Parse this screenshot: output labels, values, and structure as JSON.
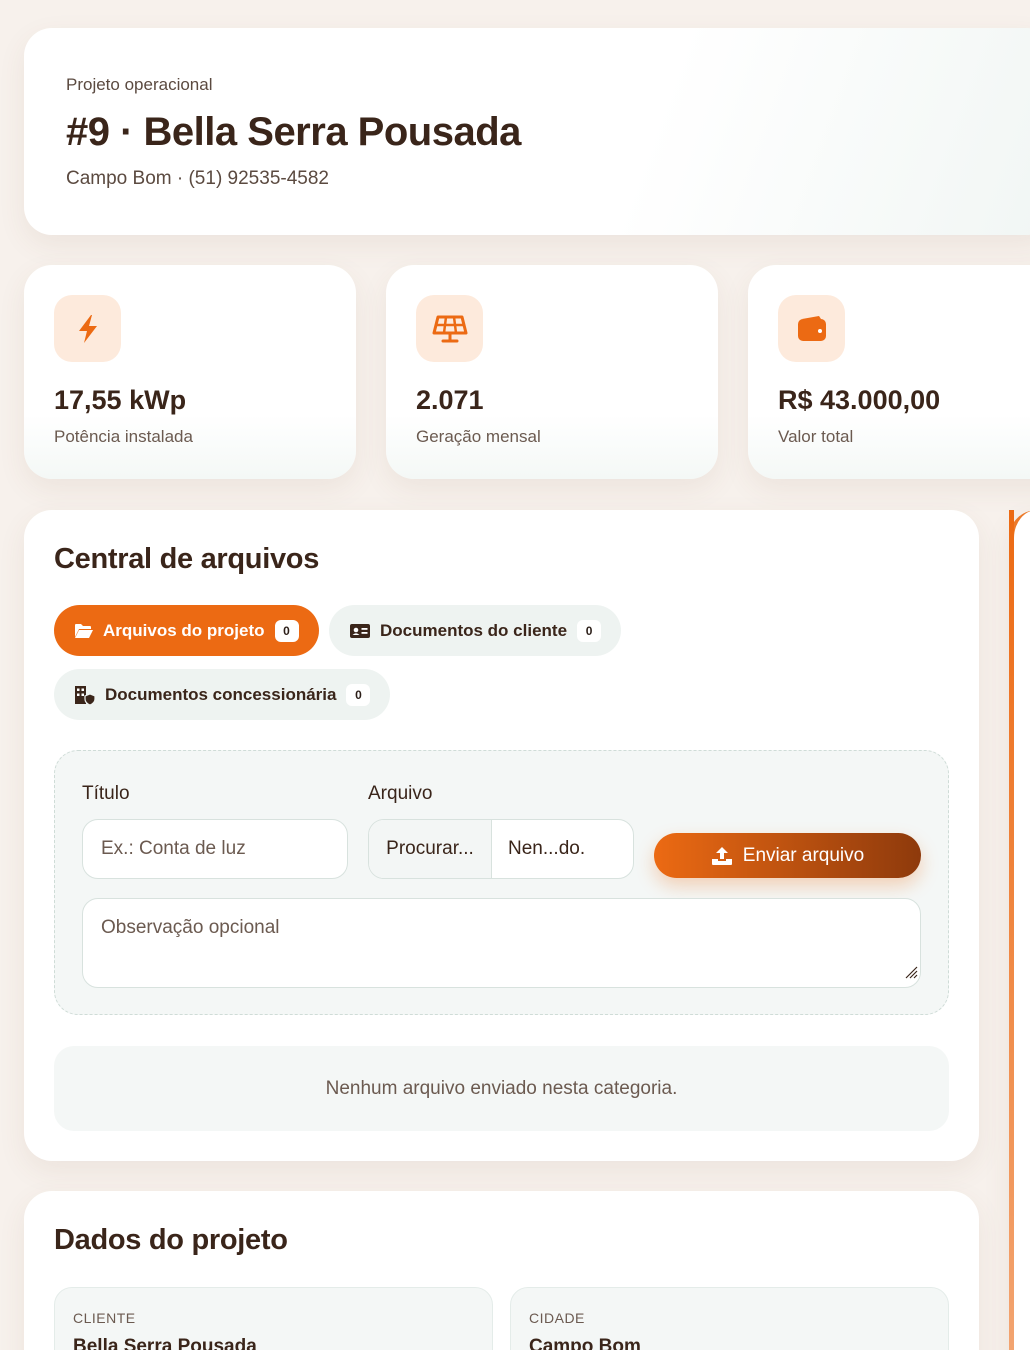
{
  "header": {
    "eyebrow": "Projeto operacional",
    "title": "#9 · Bella Serra Pousada",
    "subtitle": "Campo Bom · (51) 92535-4582"
  },
  "stats": [
    {
      "icon": "bolt-icon",
      "value": "17,55 kWp",
      "label": "Potência instalada"
    },
    {
      "icon": "solar-panel-icon",
      "value": "2.071",
      "label": "Geração mensal"
    },
    {
      "icon": "wallet-icon",
      "value": "R$ 43.000,00",
      "label": "Valor total"
    }
  ],
  "files": {
    "title": "Central de arquivos",
    "tabs": [
      {
        "label": "Arquivos do projeto",
        "count": "0",
        "icon": "folder-open-icon",
        "active": true
      },
      {
        "label": "Documentos do cliente",
        "count": "0",
        "icon": "id-card-icon",
        "active": false
      },
      {
        "label": "Documentos concessionária",
        "count": "0",
        "icon": "building-shield-icon",
        "active": false
      }
    ],
    "form": {
      "title_label": "Título",
      "title_placeholder": "Ex.: Conta de luz",
      "file_label": "Arquivo",
      "file_button": "Procurar...",
      "file_name": "Nen...do.",
      "send_label": "Enviar arquivo",
      "notes_placeholder": "Observação opcional"
    },
    "empty_message": "Nenhum arquivo enviado nesta categoria."
  },
  "project": {
    "title": "Dados do projeto",
    "fields": [
      {
        "key": "CLIENTE",
        "value": "Bella Serra Pousada"
      },
      {
        "key": "CIDADE",
        "value": "Campo Bom"
      }
    ]
  },
  "colors": {
    "accent": "#ec6a13",
    "accent_dark": "#8e3a0c",
    "icon_bg": "#fdeadc",
    "background": "#f7f1ec"
  }
}
